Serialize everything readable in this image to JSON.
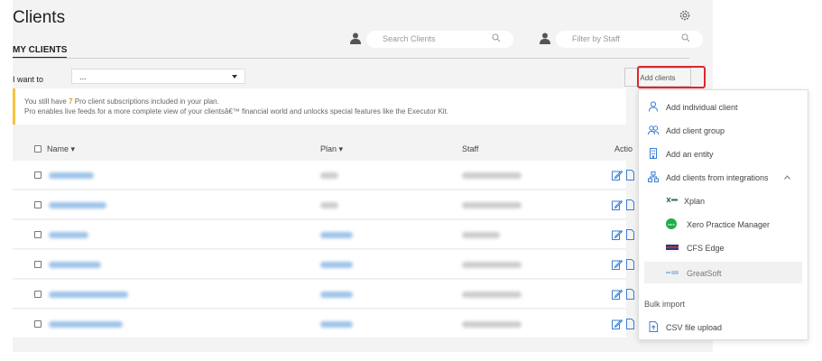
{
  "page": {
    "title": "Clients",
    "tab_label": "MY CLIENTS"
  },
  "search": {
    "clients_placeholder": "Search Clients",
    "staff_placeholder": "Filter by Staff"
  },
  "toolbar": {
    "iwant_label": "I want to",
    "iwant_value": "...",
    "add_clients_label": "Add clients"
  },
  "banner": {
    "line1_prefix": "You still have ",
    "line1_count": "7",
    "line1_suffix": " Pro client subscriptions included in your plan.",
    "line2": "Pro enables live feeds for a more complete view of your clientsâ€™ financial world and unlocks special features like the Executor Kit."
  },
  "table": {
    "columns": {
      "name": "Name ▾",
      "plan": "Plan ▾",
      "staff": "Staff",
      "actions": "Actio"
    },
    "rows": [
      {
        "plan_color": "grey"
      },
      {
        "plan_color": "grey"
      },
      {
        "plan_color": "blue"
      },
      {
        "plan_color": "blue"
      },
      {
        "plan_color": "blue"
      },
      {
        "plan_color": "blue"
      }
    ]
  },
  "menu": {
    "add_individual": "Add individual client",
    "add_group": "Add client group",
    "add_entity": "Add an entity",
    "add_integrations": "Add clients from integrations",
    "integrations": [
      "Xplan",
      "Xero Practice Manager",
      "CFS Edge",
      "GreatSoft"
    ],
    "bulk_import": "Bulk import",
    "csv_upload": "CSV file upload"
  },
  "colors": {
    "accent_blue": "#3b7fd4",
    "highlight_red": "#e0262b",
    "banner_yellow": "#f6c340"
  }
}
